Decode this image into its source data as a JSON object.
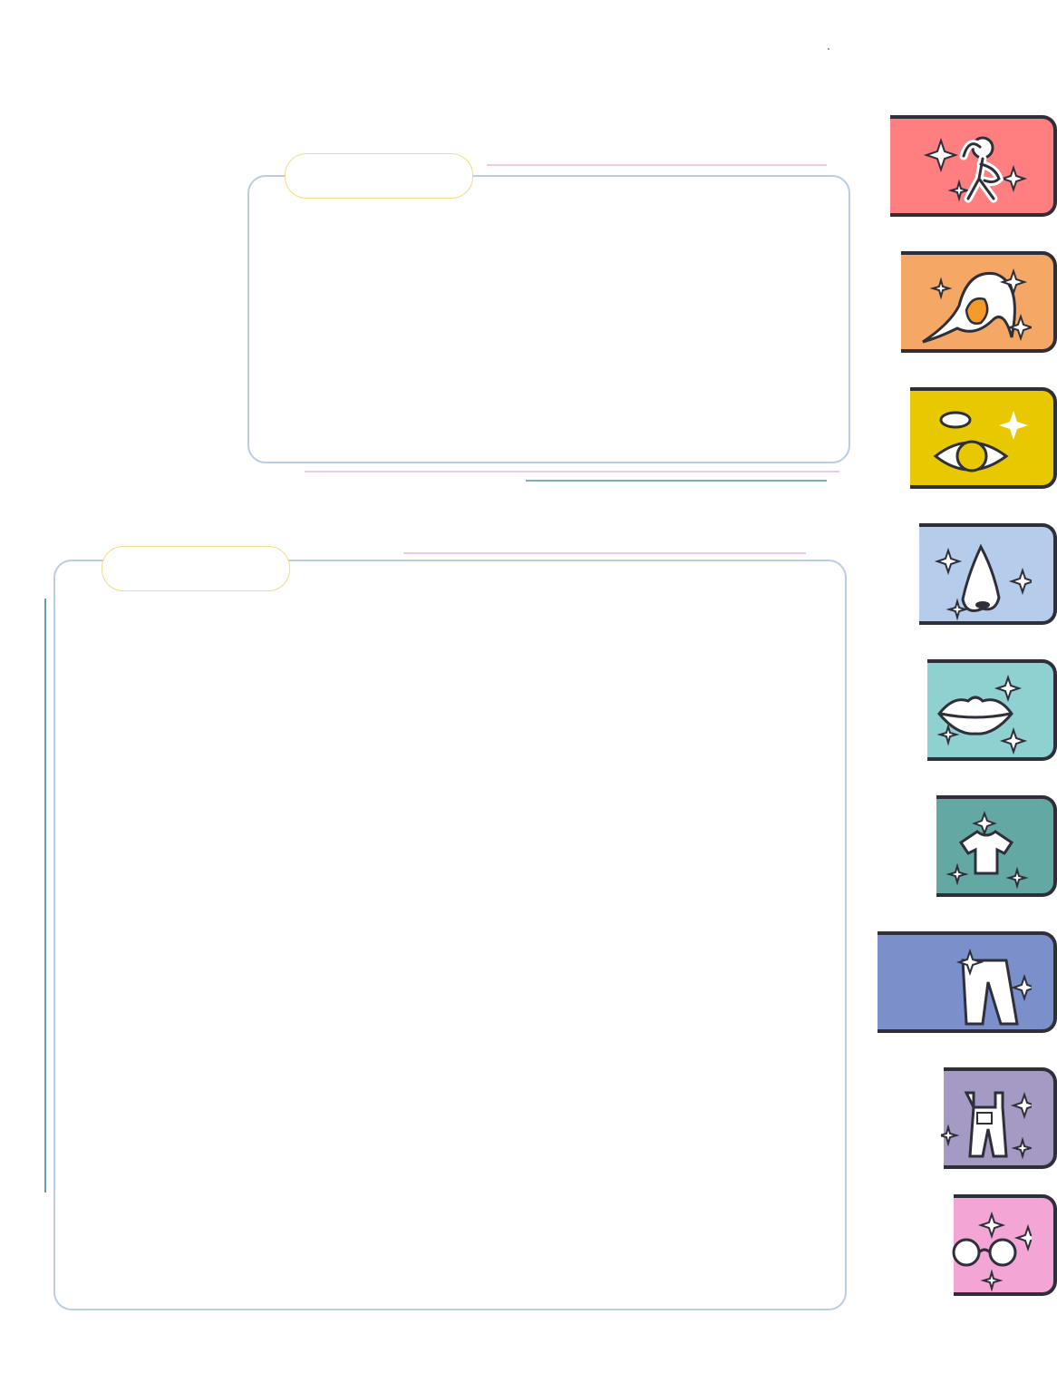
{
  "panels": {
    "top": {
      "label": ""
    },
    "bottom": {
      "label": ""
    }
  },
  "tabs": [
    {
      "id": "body",
      "icon": "body-pose-icon",
      "color": "#ff7f80"
    },
    {
      "id": "hair",
      "icon": "hair-icon",
      "color": "#f5a865"
    },
    {
      "id": "eyes",
      "icon": "eye-icon",
      "color": "#e8c800"
    },
    {
      "id": "nose",
      "icon": "nose-icon",
      "color": "#b5cdea"
    },
    {
      "id": "mouth",
      "icon": "lips-icon",
      "color": "#8fd0d0"
    },
    {
      "id": "top",
      "icon": "tshirt-icon",
      "color": "#64a8a4"
    },
    {
      "id": "pants",
      "icon": "pants-icon",
      "color": "#7b8fca"
    },
    {
      "id": "overalls",
      "icon": "overalls-icon",
      "color": "#a59ac4"
    },
    {
      "id": "glasses",
      "icon": "glasses-icon",
      "color": "#f3a5d6"
    }
  ]
}
